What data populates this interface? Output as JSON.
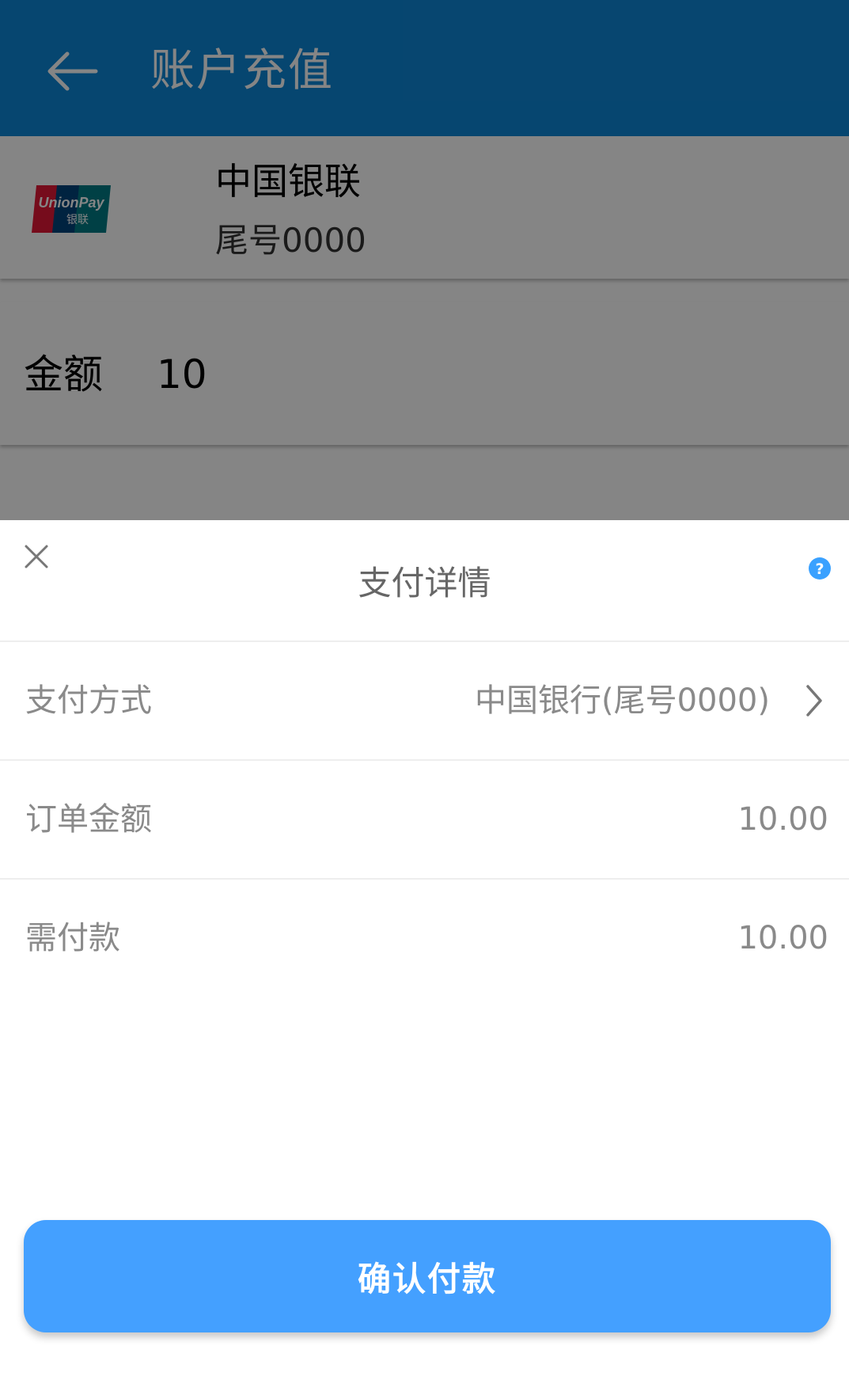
{
  "header": {
    "title": "账户充值"
  },
  "bank_card": {
    "logo_text": "UnionPay",
    "logo_sub": "银联",
    "name": "中国银联",
    "tail": "尾号0000"
  },
  "amount": {
    "label": "金额",
    "value": "10"
  },
  "payment_sheet": {
    "title": "支付详情",
    "rows": [
      {
        "label": "支付方式",
        "value": "中国银行(尾号0000)"
      },
      {
        "label": "订单金额",
        "value": "10.00"
      },
      {
        "label": "需付款",
        "value": "10.00"
      }
    ],
    "confirm_label": "确认付款"
  },
  "colors": {
    "app_bar": "#0d86d6",
    "accent_button": "#44a0ff",
    "help_icon": "#3aa1ff",
    "secondary_text": "#8a8a8a"
  },
  "icons": {
    "back": "back-arrow-icon",
    "close": "close-icon",
    "help": "help-icon",
    "chevron": "chevron-right-icon",
    "logo": "unionpay-logo"
  }
}
